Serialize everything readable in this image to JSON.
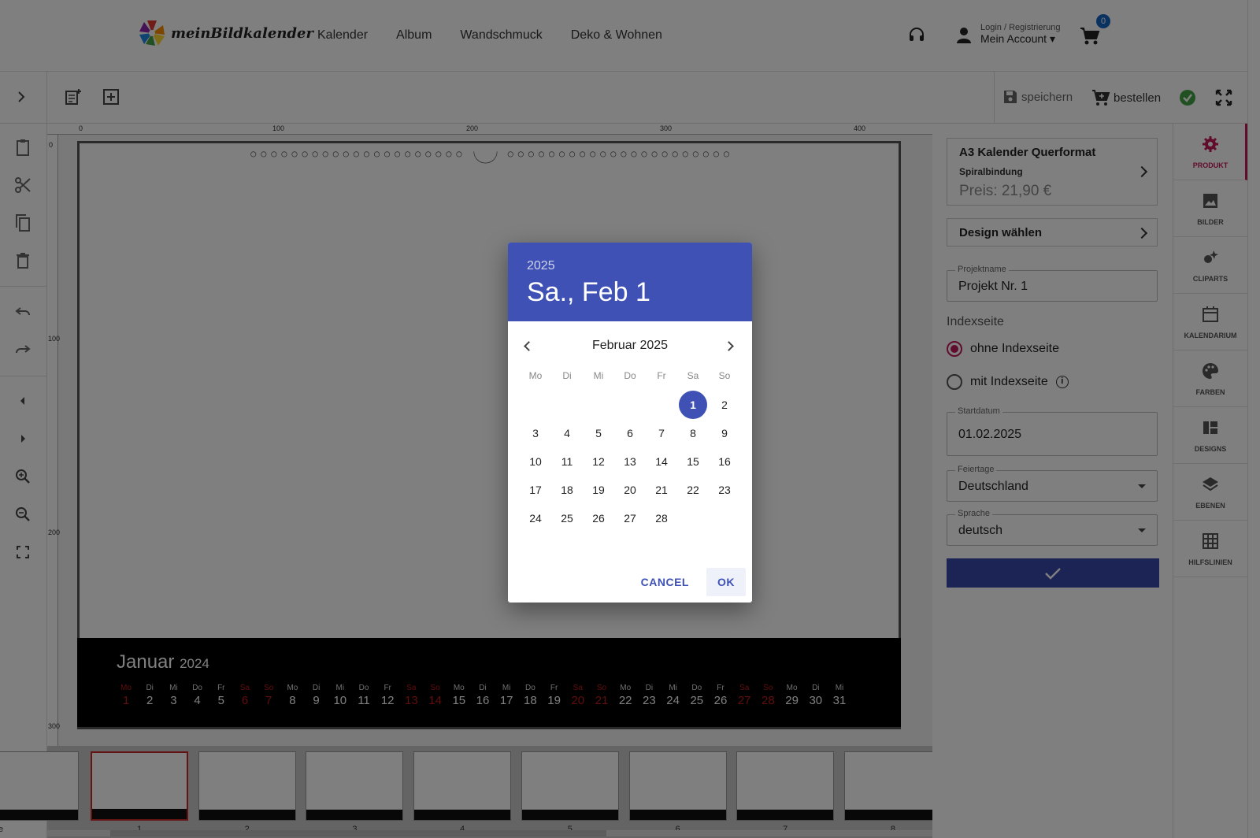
{
  "header": {
    "brand": "meinBildkalender",
    "nav": [
      "Kalender",
      "Album",
      "Wandschmuck",
      "Deko & Wohnen"
    ],
    "account_small": "Login / Registrierung",
    "account_big": "Mein Account",
    "cart_count": "0"
  },
  "toolbar": {
    "save_label": "speichern",
    "order_label": "bestellen"
  },
  "ruler": {
    "top_ticks": [
      "0",
      "100",
      "200",
      "300",
      "400"
    ],
    "left_ticks": [
      "0",
      "100",
      "200",
      "300"
    ]
  },
  "calendar_page": {
    "month": "Januar",
    "year": "2024",
    "days": [
      {
        "wd": "Mo",
        "d": "1",
        "we": true
      },
      {
        "wd": "Di",
        "d": "2",
        "we": false
      },
      {
        "wd": "Mi",
        "d": "3",
        "we": false
      },
      {
        "wd": "Do",
        "d": "4",
        "we": false
      },
      {
        "wd": "Fr",
        "d": "5",
        "we": false
      },
      {
        "wd": "Sa",
        "d": "6",
        "we": true
      },
      {
        "wd": "So",
        "d": "7",
        "we": true
      },
      {
        "wd": "Mo",
        "d": "8",
        "we": false
      },
      {
        "wd": "Di",
        "d": "9",
        "we": false
      },
      {
        "wd": "Mi",
        "d": "10",
        "we": false
      },
      {
        "wd": "Do",
        "d": "11",
        "we": false
      },
      {
        "wd": "Fr",
        "d": "12",
        "we": false
      },
      {
        "wd": "Sa",
        "d": "13",
        "we": true
      },
      {
        "wd": "So",
        "d": "14",
        "we": true
      },
      {
        "wd": "Mo",
        "d": "15",
        "we": false
      },
      {
        "wd": "Di",
        "d": "16",
        "we": false
      },
      {
        "wd": "Mi",
        "d": "17",
        "we": false
      },
      {
        "wd": "Do",
        "d": "18",
        "we": false
      },
      {
        "wd": "Fr",
        "d": "19",
        "we": false
      },
      {
        "wd": "Sa",
        "d": "20",
        "we": true
      },
      {
        "wd": "So",
        "d": "21",
        "we": true
      },
      {
        "wd": "Mo",
        "d": "22",
        "we": false
      },
      {
        "wd": "Di",
        "d": "23",
        "we": false
      },
      {
        "wd": "Mi",
        "d": "24",
        "we": false
      },
      {
        "wd": "Do",
        "d": "25",
        "we": false
      },
      {
        "wd": "Fr",
        "d": "26",
        "we": false
      },
      {
        "wd": "Sa",
        "d": "27",
        "we": true
      },
      {
        "wd": "So",
        "d": "28",
        "we": true
      },
      {
        "wd": "Mo",
        "d": "29",
        "we": false
      },
      {
        "wd": "Di",
        "d": "30",
        "we": false
      },
      {
        "wd": "Mi",
        "d": "31",
        "we": false
      }
    ]
  },
  "filmstrip": {
    "pages": [
      "1",
      "2",
      "3",
      "4",
      "5",
      "6",
      "7",
      "8"
    ],
    "selected_page": "1",
    "partial_label": "e"
  },
  "product": {
    "title": "A3 Kalender Querformat",
    "binding": "Spiralbindung",
    "price": "Preis: 21,90 €",
    "design_label": "Design wählen",
    "project_label": "Projektname",
    "project_value": "Projekt Nr. 1",
    "index_section": "Indexseite",
    "index_options": [
      "ohne Indexseite",
      "mit Indexseite"
    ],
    "index_selected": "ohne Indexseite",
    "start_label": "Startdatum",
    "start_value": "01.02.2025",
    "holiday_label": "Feiertage",
    "holiday_value": "Deutschland",
    "lang_label": "Sprache",
    "lang_value": "deutsch"
  },
  "right_tabs": [
    "PRODUKT",
    "BILDER",
    "CLIPARTS",
    "KALENDARIUM",
    "FARBEN",
    "DESIGNS",
    "EBENEN",
    "HILFSLINIEN"
  ],
  "right_tab_icons": [
    "gear-icon",
    "image-icon",
    "clipart-icon",
    "calendar-icon",
    "palette-icon",
    "designs-icon",
    "layers-icon",
    "grid-icon"
  ],
  "active_tab": "PRODUKT",
  "datepicker": {
    "year": "2025",
    "selected_label": "Sa., Feb 1",
    "month_label": "Februar 2025",
    "weekdays": [
      "Mo",
      "Di",
      "Mi",
      "Do",
      "Fr",
      "Sa",
      "So"
    ],
    "first_weekday_index": 5,
    "days_in_month": 28,
    "selected_day": 1,
    "cancel_label": "CANCEL",
    "ok_label": "OK"
  },
  "colors": {
    "accent": "#3f51b5",
    "active_tab": "#c2185b",
    "weekend": "#c21b1b",
    "apply_button": "#3949ab"
  }
}
